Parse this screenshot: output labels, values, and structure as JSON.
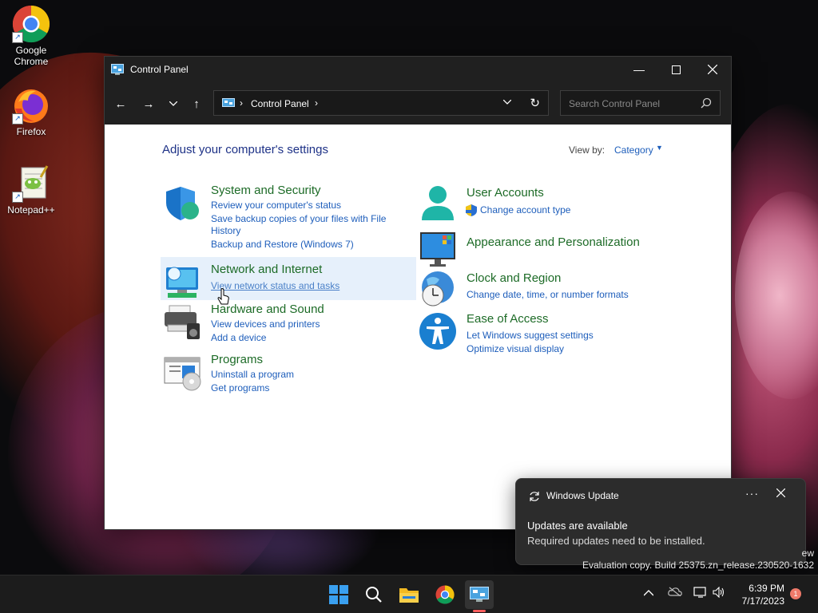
{
  "desktop": {
    "icons": [
      {
        "label": "Google Chrome"
      },
      {
        "label": "Firefox"
      },
      {
        "label": "Notepad++"
      }
    ]
  },
  "window": {
    "title": "Control Panel",
    "address": {
      "crumb": "Control Panel"
    },
    "search": {
      "placeholder": "Search Control Panel"
    }
  },
  "page": {
    "heading": "Adjust your computer's settings",
    "view_by_label": "View by:",
    "view_by_value": "Category"
  },
  "categories": {
    "system": {
      "title": "System and Security",
      "links": [
        "Review your computer's status",
        "Save backup copies of your files with File",
        "History",
        "Backup and Restore (Windows 7)"
      ]
    },
    "network": {
      "title": "Network and Internet",
      "links": [
        "View network status and tasks"
      ]
    },
    "hardware": {
      "title": "Hardware and Sound",
      "links": [
        "View devices and printers",
        "Add a device"
      ]
    },
    "programs": {
      "title": "Programs",
      "links": [
        "Uninstall a program",
        "Get programs"
      ]
    },
    "users": {
      "title": "User Accounts",
      "links": [
        "Change account type"
      ]
    },
    "appearance": {
      "title": "Appearance and Personalization",
      "links": []
    },
    "clock": {
      "title": "Clock and Region",
      "links": [
        "Change date, time, or number formats"
      ]
    },
    "ease": {
      "title": "Ease of Access",
      "links": [
        "Let Windows suggest settings",
        "Optimize visual display"
      ]
    }
  },
  "notification": {
    "app": "Windows Update",
    "more": "···",
    "heading": "Updates are available",
    "body": "Required updates need to be installed."
  },
  "watermark": {
    "line1": "ew",
    "line2": "Evaluation copy. Build 25375.zn_release.230520-1632"
  },
  "taskbar": {
    "time": "6:39 PM",
    "date": "7/17/2023",
    "badge": "1"
  },
  "colors": {
    "accent_link": "#1e5ebb",
    "category_title": "#1d6b27",
    "heading": "#1e3287",
    "titlebar": "#202020"
  }
}
